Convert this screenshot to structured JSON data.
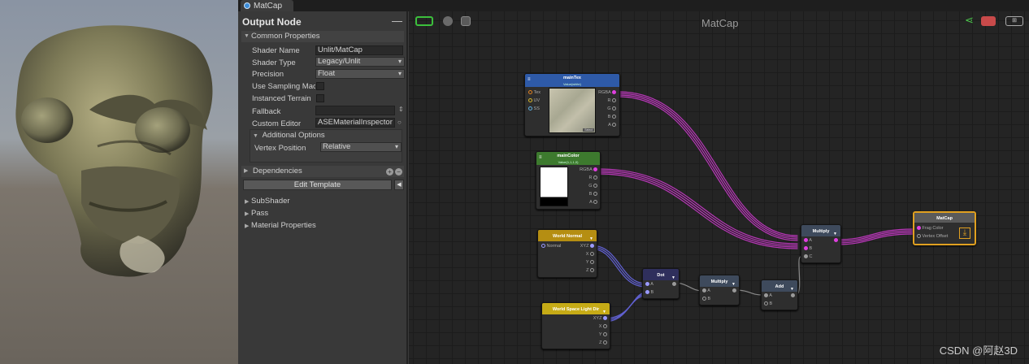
{
  "window": {
    "tab_title": "MatCap"
  },
  "inspector": {
    "header": "Output Node",
    "collapse_glyph": "—",
    "common": {
      "title": "Common Properties",
      "shader_name_label": "Shader Name",
      "shader_name_value": "Unlit/MatCap",
      "shader_type_label": "Shader Type",
      "shader_type_value": "Legacy/Unlit",
      "precision_label": "Precision",
      "precision_value": "Float",
      "use_sampling_label": "Use Sampling Mac",
      "instanced_label": "Instanced Terrain",
      "fallback_label": "Fallback",
      "fallback_value": "",
      "custom_editor_label": "Custom Editor",
      "custom_editor_value": "ASEMaterialInspector",
      "additional_title": "Additional Options",
      "vertex_position_label": "Vertex Position",
      "vertex_position_value": "Relative"
    },
    "dependencies_title": "Dependencies",
    "edit_template_label": "Edit Template",
    "sections": [
      "SubShader",
      "Pass",
      "Material Properties"
    ]
  },
  "canvas": {
    "title": "MatCap",
    "nodes": {
      "main_tex": {
        "title": "mainTex",
        "subtitle": "Value(white)",
        "inputs": [
          "Tex",
          "UV",
          "SS"
        ],
        "outputs": [
          "RGBA",
          "R",
          "G",
          "B",
          "A"
        ],
        "thumb_badge": "Select"
      },
      "main_color": {
        "title": "mainColor",
        "subtitle": "Value(1,1,1,0)",
        "outputs": [
          "RGBA",
          "R",
          "G",
          "B",
          "A"
        ]
      },
      "world_normal": {
        "title": "World Normal",
        "inputs": [
          "Normal"
        ],
        "outputs": [
          "XYZ",
          "X",
          "Y",
          "Z"
        ]
      },
      "light_dir": {
        "title": "World Space Light Dir",
        "outputs": [
          "XYZ",
          "X",
          "Y",
          "Z"
        ]
      },
      "dot": {
        "title": "Dot",
        "inputs": [
          "A",
          "B"
        ]
      },
      "multiply1": {
        "title": "Multiply",
        "inputs": [
          "A",
          "B"
        ]
      },
      "add": {
        "title": "Add",
        "inputs": [
          "A",
          "B"
        ]
      },
      "multiply2": {
        "title": "Multiply",
        "inputs": [
          "A",
          "B",
          "C"
        ]
      },
      "output": {
        "title": "MatCap",
        "inputs": [
          "Frag Color",
          "Vertex Offset"
        ]
      }
    }
  },
  "watermark": "CSDN @阿赵3D",
  "colors": {
    "tex_header": "#2e5aa8",
    "color_header": "#3d7a2e",
    "normal_header": "#b58e12",
    "op_header": "#3e4a5c",
    "dot_header": "#2f2f5c",
    "wire_rgba": "#c03ac0",
    "wire_vec": "#6a6ad8",
    "output_border": "#e0a020"
  }
}
